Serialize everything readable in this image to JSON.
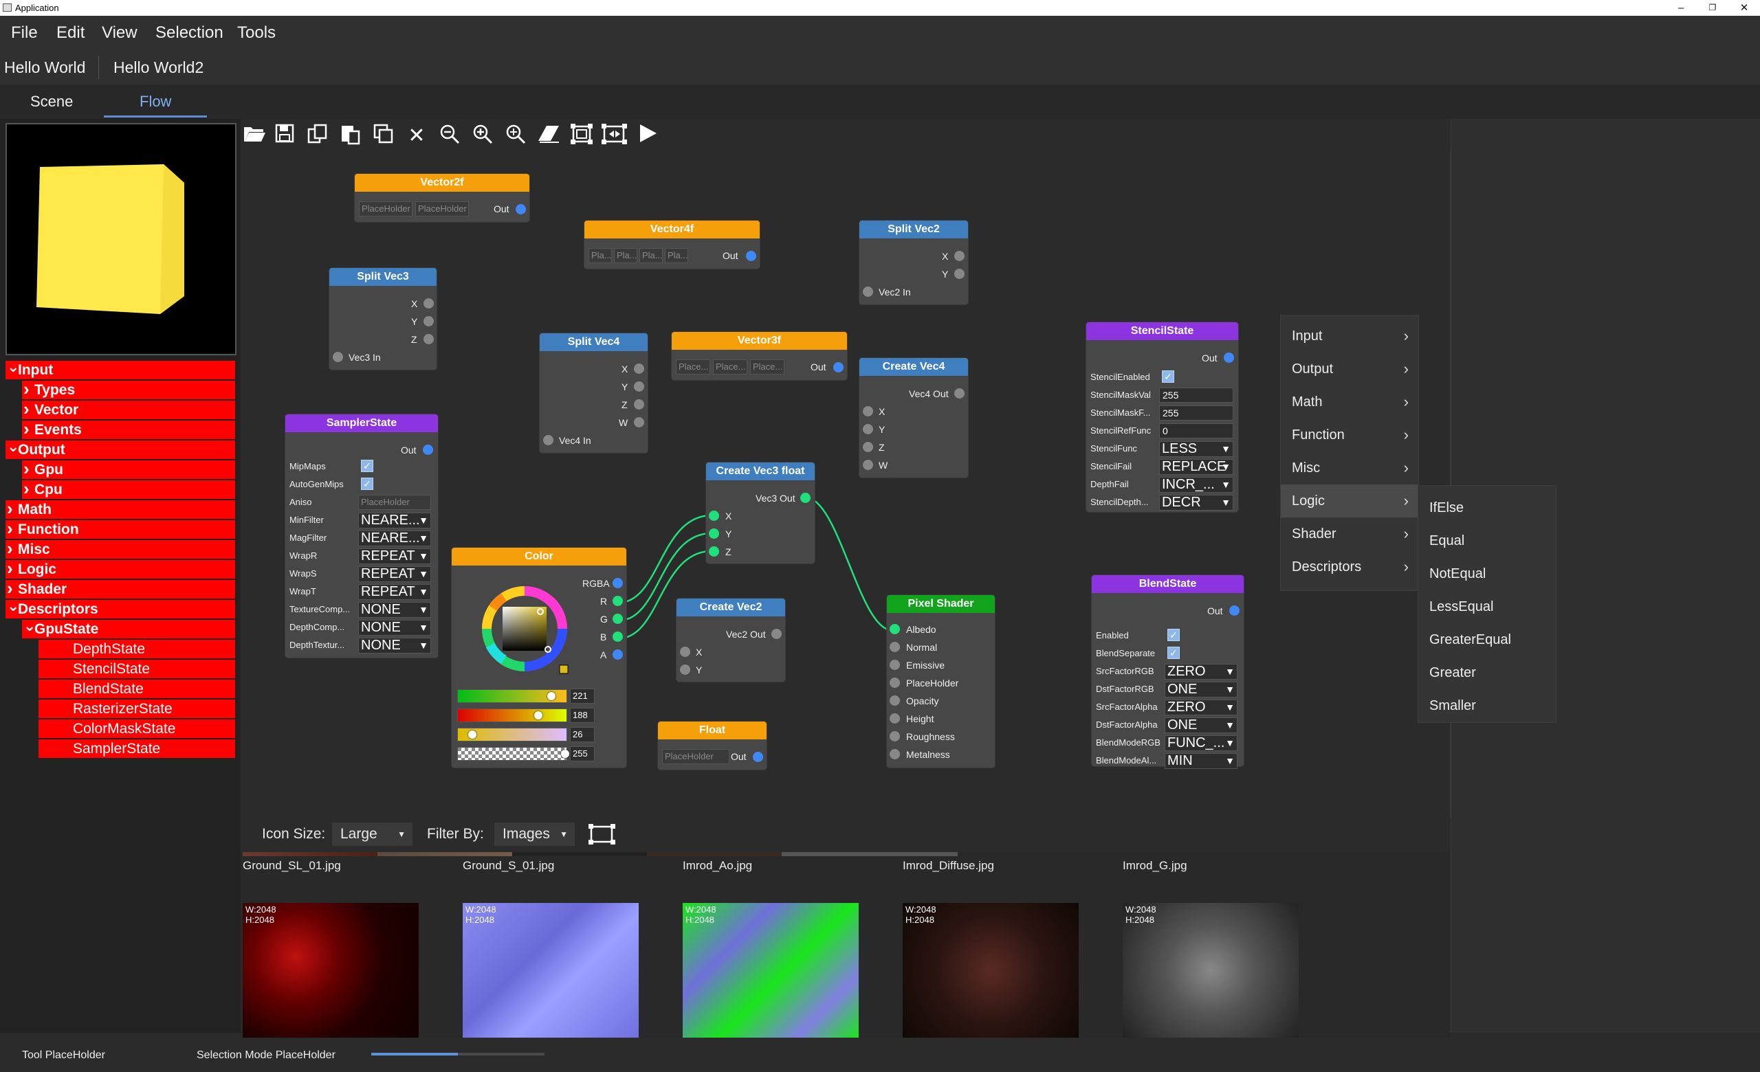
{
  "window": {
    "title": "Application"
  },
  "menubar": {
    "items": [
      "File",
      "Edit",
      "View",
      "Selection",
      "Tools"
    ]
  },
  "documents": {
    "tabs": [
      "Hello World",
      "Hello World2"
    ]
  },
  "views": {
    "tabs": [
      "Scene",
      "Flow"
    ],
    "active": "Flow"
  },
  "tree": {
    "items": [
      {
        "label": "Input",
        "level": 0,
        "expanded": true
      },
      {
        "label": "Types",
        "level": 1,
        "expanded": false
      },
      {
        "label": "Vector",
        "level": 1,
        "expanded": false
      },
      {
        "label": "Events",
        "level": 1,
        "expanded": false
      },
      {
        "label": "Output",
        "level": 0,
        "expanded": true
      },
      {
        "label": "Gpu",
        "level": 1,
        "expanded": false
      },
      {
        "label": "Cpu",
        "level": 1,
        "expanded": false
      },
      {
        "label": "Math",
        "level": 0,
        "expanded": false
      },
      {
        "label": "Function",
        "level": 0,
        "expanded": false
      },
      {
        "label": "Misc",
        "level": 0,
        "expanded": false
      },
      {
        "label": "Logic",
        "level": 0,
        "expanded": false
      },
      {
        "label": "Shader",
        "level": 0,
        "expanded": false
      },
      {
        "label": "Descriptors",
        "level": 0,
        "expanded": true
      },
      {
        "label": "GpuState",
        "level": 1,
        "expanded": true
      },
      {
        "label": "DepthState",
        "level": 2,
        "leaf": true
      },
      {
        "label": "StencilState",
        "level": 2,
        "leaf": true
      },
      {
        "label": "BlendState",
        "level": 2,
        "leaf": true
      },
      {
        "label": "RasterizerState",
        "level": 2,
        "leaf": true
      },
      {
        "label": "ColorMaskState",
        "level": 2,
        "leaf": true
      },
      {
        "label": "SamplerState",
        "level": 2,
        "leaf": true
      }
    ]
  },
  "toolbar": {
    "icons": [
      "open-icon",
      "save-icon",
      "copy-icon",
      "paste-icon",
      "duplicate-icon",
      "delete-icon",
      "zoom-out-icon",
      "zoom-in-icon",
      "zoom-reset-icon",
      "eraser-icon",
      "fit-selection-icon",
      "fit-all-icon",
      "play-icon"
    ]
  },
  "nodes": {
    "vector2f": {
      "title": "Vector2f",
      "ph1": "PlaceHolder",
      "ph2": "PlaceHolder",
      "out": "Out"
    },
    "vector4f": {
      "title": "Vector4f",
      "ph": [
        "Pla...",
        "Pla...",
        "Pla...",
        "Pla..."
      ],
      "out": "Out"
    },
    "splitvec2": {
      "title": "Split Vec2",
      "x": "X",
      "y": "Y",
      "in": "Vec2 In"
    },
    "splitvec3": {
      "title": "Split Vec3",
      "x": "X",
      "y": "Y",
      "z": "Z",
      "in": "Vec3 In"
    },
    "splitvec4": {
      "title": "Split Vec4",
      "x": "X",
      "y": "Y",
      "z": "Z",
      "w": "W",
      "in": "Vec4 In"
    },
    "vector3f": {
      "title": "Vector3f",
      "ph": [
        "Place...",
        "Place...",
        "Place..."
      ],
      "out": "Out"
    },
    "createvec4": {
      "title": "Create Vec4",
      "out": "Vec4 Out",
      "x": "X",
      "y": "Y",
      "z": "Z",
      "w": "W"
    },
    "stencil": {
      "title": "StencilState",
      "out": "Out",
      "rows": [
        {
          "label": "StencilEnabled",
          "type": "check"
        },
        {
          "label": "StencilMaskVal",
          "type": "field",
          "value": "255"
        },
        {
          "label": "StencilMaskF...",
          "type": "field",
          "value": "255"
        },
        {
          "label": "StencilRefFunc",
          "type": "field",
          "value": "0"
        },
        {
          "label": "StencilFunc",
          "type": "combo",
          "value": "LESS"
        },
        {
          "label": "StencilFail",
          "type": "combo",
          "value": "REPLACE"
        },
        {
          "label": "DepthFail",
          "type": "combo",
          "value": "INCR_..."
        },
        {
          "label": "StencilDepth...",
          "type": "combo",
          "value": "DECR"
        }
      ]
    },
    "sampler": {
      "title": "SamplerState",
      "out": "Out",
      "rows": [
        {
          "label": "MipMaps",
          "type": "check"
        },
        {
          "label": "AutoGenMips",
          "type": "check"
        },
        {
          "label": "Aniso",
          "type": "ph",
          "value": "PlaceHolder"
        },
        {
          "label": "MinFilter",
          "type": "combo",
          "value": "NEARE..."
        },
        {
          "label": "MagFilter",
          "type": "combo",
          "value": "NEARE..."
        },
        {
          "label": "WrapR",
          "type": "combo",
          "value": "REPEAT"
        },
        {
          "label": "WrapS",
          "type": "combo",
          "value": "REPEAT"
        },
        {
          "label": "WrapT",
          "type": "combo",
          "value": "REPEAT"
        },
        {
          "label": "TextureComp...",
          "type": "combo",
          "value": "NONE"
        },
        {
          "label": "DepthComp...",
          "type": "combo",
          "value": "NONE"
        },
        {
          "label": "DepthTextur...",
          "type": "combo",
          "value": "NONE"
        }
      ]
    },
    "createvec3": {
      "title": "Create Vec3 float",
      "out": "Vec3 Out",
      "x": "X",
      "y": "Y",
      "z": "Z"
    },
    "color": {
      "title": "Color",
      "rgba": "RGBA",
      "r": "R",
      "g": "G",
      "b": "B",
      "a": "A",
      "values": {
        "r": "221",
        "g": "188",
        "b": "26",
        "a": "255"
      },
      "sliders": {
        "r": 0.867,
        "g": 0.737,
        "b": 0.102,
        "a": 1.0
      }
    },
    "createvec2": {
      "title": "Create Vec2",
      "out": "Vec2 Out",
      "x": "X",
      "y": "Y"
    },
    "float": {
      "title": "Float",
      "ph": "PlaceHolder",
      "out": "Out"
    },
    "pixel": {
      "title": "Pixel Shader",
      "inputs": [
        "Albedo",
        "Normal",
        "Emissive",
        "PlaceHolder",
        "Opacity",
        "Height",
        "Roughness",
        "Metalness"
      ]
    },
    "blend": {
      "title": "BlendState",
      "out": "Out",
      "rows": [
        {
          "label": "Enabled",
          "type": "check"
        },
        {
          "label": "BlendSeparate",
          "type": "check"
        },
        {
          "label": "SrcFactorRGB",
          "type": "combo",
          "value": "ZERO"
        },
        {
          "label": "DstFactorRGB",
          "type": "combo",
          "value": "ONE"
        },
        {
          "label": "SrcFactorAlpha",
          "type": "combo",
          "value": "ZERO"
        },
        {
          "label": "DstFactorAlpha",
          "type": "combo",
          "value": "ONE"
        },
        {
          "label": "BlendModeRGB",
          "type": "combo",
          "value": "FUNC_..."
        },
        {
          "label": "BlendModeAl...",
          "type": "combo",
          "value": "MIN"
        }
      ]
    }
  },
  "context_menu": {
    "items": [
      "Input",
      "Output",
      "Math",
      "Function",
      "Misc",
      "Logic",
      "Shader",
      "Descriptors"
    ],
    "highlighted": "Logic",
    "submenu": [
      "IfElse",
      "Equal",
      "NotEqual",
      "LessEqual",
      "GreaterEqual",
      "Greater",
      "Smaller"
    ]
  },
  "assets": {
    "icon_size_label": "Icon Size:",
    "icon_size_value": "Large",
    "filter_label": "Filter By:",
    "filter_value": "Images",
    "top_files": [
      "Ground_SL_01.jpg",
      "Ground_S_01.jpg",
      "Imrod_Ao.jpg",
      "Imrod_Diffuse.jpg",
      "Imrod_G.jpg"
    ],
    "thumbs": [
      {
        "w": "W:2048",
        "h": "H:2048"
      },
      {
        "w": "W:2048",
        "h": "H:2048"
      },
      {
        "w": "W:2048",
        "h": "H:2048"
      },
      {
        "w": "W:2048",
        "h": "H:2048"
      },
      {
        "w": "W:2048",
        "h": "H:2048"
      }
    ]
  },
  "status": {
    "tool": "Tool PlaceHolder",
    "selection": "Selection Mode PlaceHolder",
    "progress": 0.5
  },
  "colors": {
    "tree_bg": "#ff0000",
    "cube": "#ffe84a",
    "accent": "#5d8bd4",
    "pin_blue": "#3f88f5",
    "pin_green": "#1fe07a"
  }
}
